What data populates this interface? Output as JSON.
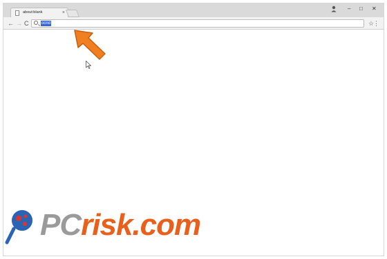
{
  "browser": {
    "tab_title": "about:blank",
    "tab_close": "×",
    "address": "ocnd",
    "controls": {
      "minimize": "–",
      "maximize": "□",
      "close": "✕"
    },
    "nav": {
      "back": "←",
      "forward": "→",
      "reload": "C"
    },
    "menu": "⋮",
    "account_icon": "person-icon"
  },
  "overlay": {
    "arrow_color": "#f07f21",
    "logo_pc": "PC",
    "logo_risk": "risk.com",
    "logo_pc_color": "#9a9a9a",
    "logo_risk_color": "#e8601c"
  }
}
